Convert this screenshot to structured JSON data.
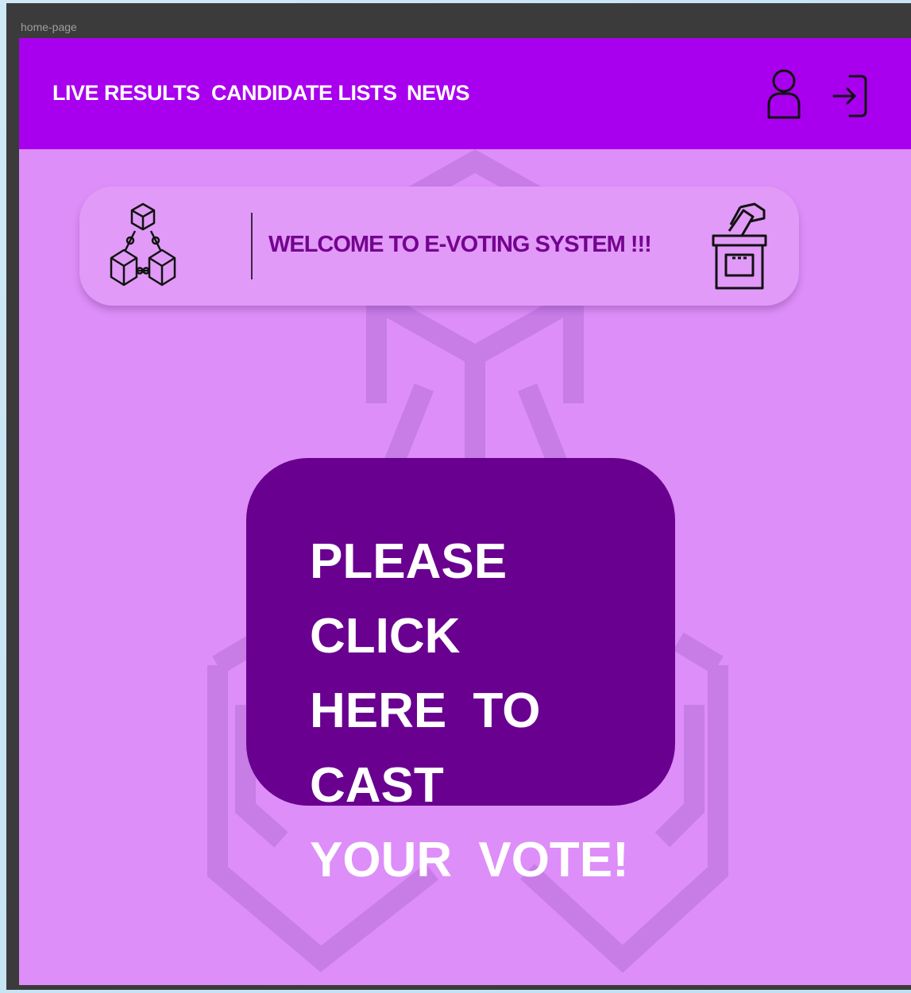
{
  "window": {
    "title": "home-page"
  },
  "navbar": {
    "links": [
      {
        "label": "LIVE RESULTS"
      },
      {
        "label": "CANDIDATE LISTS"
      },
      {
        "label": "NEWS"
      }
    ],
    "icons": {
      "profile": "user-profile-icon",
      "login": "login-icon"
    },
    "background_color": "#a800ee"
  },
  "welcome": {
    "text": "WELCOME TO E-VOTING SYSTEM !!!",
    "left_icon": "blockchain-icon",
    "right_icon": "ballot-box-icon",
    "text_color": "#74038f"
  },
  "vote_button": {
    "line1": "PLEASE CLICK",
    "line2": "HERE TO CAST",
    "line3": "YOUR VOTE!",
    "background_color": "#69008f"
  },
  "colors": {
    "page_background": "#dd8ef8",
    "card_background": "#e19af7"
  }
}
